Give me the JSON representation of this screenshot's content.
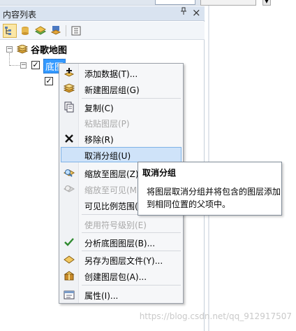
{
  "panel": {
    "title": "内容列表",
    "pin_glyph": "ᵩ",
    "close_glyph": "×"
  },
  "toolbar": {
    "buttons": [
      {
        "name": "list-by-drawing-order-icon"
      },
      {
        "name": "list-by-source-icon"
      },
      {
        "name": "list-by-visibility-icon"
      },
      {
        "name": "list-by-selection-icon"
      },
      {
        "name": "options-icon"
      }
    ]
  },
  "tree": {
    "root_label": "谷歌地图",
    "child_label": "底图",
    "expand_glyph": "⊟",
    "check_glyph": "✓"
  },
  "menu": {
    "items": [
      {
        "label": "添加数据(T)...",
        "icon": "add-data-icon",
        "disabled": false
      },
      {
        "label": "新建图层组(G)",
        "icon": "new-group-layer-icon",
        "disabled": false
      },
      {
        "label": "复制(C)",
        "icon": "copy-icon",
        "disabled": false
      },
      {
        "label": "粘贴图层(P)",
        "icon": "paste-icon",
        "disabled": true
      },
      {
        "label": "移除(R)",
        "icon": "remove-icon",
        "disabled": false
      },
      {
        "label": "取消分组(U)",
        "icon": "",
        "disabled": false,
        "highlight": true
      },
      {
        "label": "缩放至图层(Z)",
        "icon": "zoom-to-layer-icon",
        "disabled": false
      },
      {
        "label": "缩放至可见(M)",
        "icon": "zoom-to-visible-icon",
        "disabled": true
      },
      {
        "label": "可见比例范围(S)",
        "icon": "",
        "disabled": false
      },
      {
        "label": "使用符号级别(E)",
        "icon": "",
        "disabled": true
      },
      {
        "label": "分析底图图层(B)...",
        "icon": "checkmark-icon",
        "disabled": false
      },
      {
        "label": "另存为图层文件(Y)...",
        "icon": "save-layer-file-icon",
        "disabled": false
      },
      {
        "label": "创建图层包(A)...",
        "icon": "layer-package-icon",
        "disabled": false
      },
      {
        "label": "属性(I)...",
        "icon": "properties-icon",
        "disabled": false
      }
    ]
  },
  "tooltip": {
    "title": "取消分组",
    "body": "将图层取消分组并将包含的图层添加到相同位置的父项中。"
  },
  "watermark": "https://blog.csdn.net/qq_912917507",
  "colors": {
    "panel_title_bg": "#d9e3f0",
    "menu_bg": "#f6f7f9",
    "highlight_bg": "#cfe3f9",
    "highlight_border": "#7eb2e6",
    "selected_label_bg": "#3399ff"
  }
}
